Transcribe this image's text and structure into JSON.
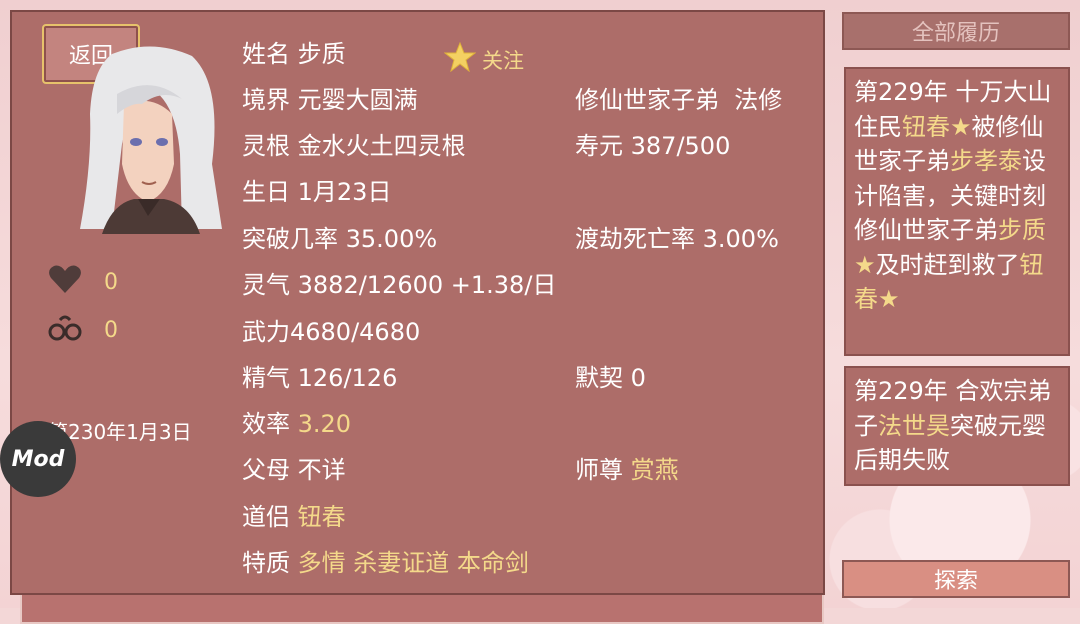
{
  "back_label": "返回",
  "follow_label": "关注",
  "stats": {
    "heart": "0",
    "cuffs": "0"
  },
  "date": "第230年1月3日",
  "mod_label": "Mod",
  "profile": {
    "name_label": "姓名",
    "name": "步质",
    "realm_label": "境界",
    "realm": "元婴大圆满",
    "identity": "修仙世家子弟",
    "sect": "法修",
    "root_label": "灵根",
    "root": "金水火土四灵根",
    "life_label": "寿元",
    "life": "387/500",
    "birth_label": "生日",
    "birth": "1月23日",
    "break_label": "突破几率",
    "break": "35.00%",
    "death_label": "渡劫死亡率",
    "death": "3.00%",
    "qi_label": "灵气",
    "qi": "3882/12600 +1.38/日",
    "force_label": "武力",
    "force": "4680/4680",
    "essence_label": "精气",
    "essence": "126/126",
    "rapport_label": "默契",
    "rapport": "0",
    "eff_label": "效率",
    "eff": "3.20",
    "parents_label": "父母",
    "parents": "不详",
    "master_label": "师尊",
    "master": "赏燕",
    "partner_label": "道侣",
    "partner": "钮春",
    "traits_label": "特质",
    "traits": [
      "多情",
      "杀妻证道",
      "本命剑"
    ]
  },
  "history_button": "全部履历",
  "explore_button": "探索",
  "history": [
    {
      "parts": [
        {
          "t": "第229年 十万大山住民",
          "h": false
        },
        {
          "t": "钮春★",
          "h": true
        },
        {
          "t": "被修仙世家子弟",
          "h": false
        },
        {
          "t": "步孝泰",
          "h": true
        },
        {
          "t": "设计陷害，关键时刻修仙世家子弟",
          "h": false
        },
        {
          "t": "步质★",
          "h": true
        },
        {
          "t": "及时赶到救了",
          "h": false
        },
        {
          "t": "钮春★",
          "h": true
        }
      ]
    },
    {
      "parts": [
        {
          "t": "第229年 合欢宗弟子",
          "h": false
        },
        {
          "t": "法世昊",
          "h": true
        },
        {
          "t": "突破元婴后期失败",
          "h": false
        }
      ]
    }
  ],
  "colors": {
    "panel": "#ad6d69",
    "highlight": "#f4d98a",
    "text": "#ffffff"
  },
  "icons": [
    "heart-icon",
    "handcuffs-icon",
    "star-icon"
  ]
}
